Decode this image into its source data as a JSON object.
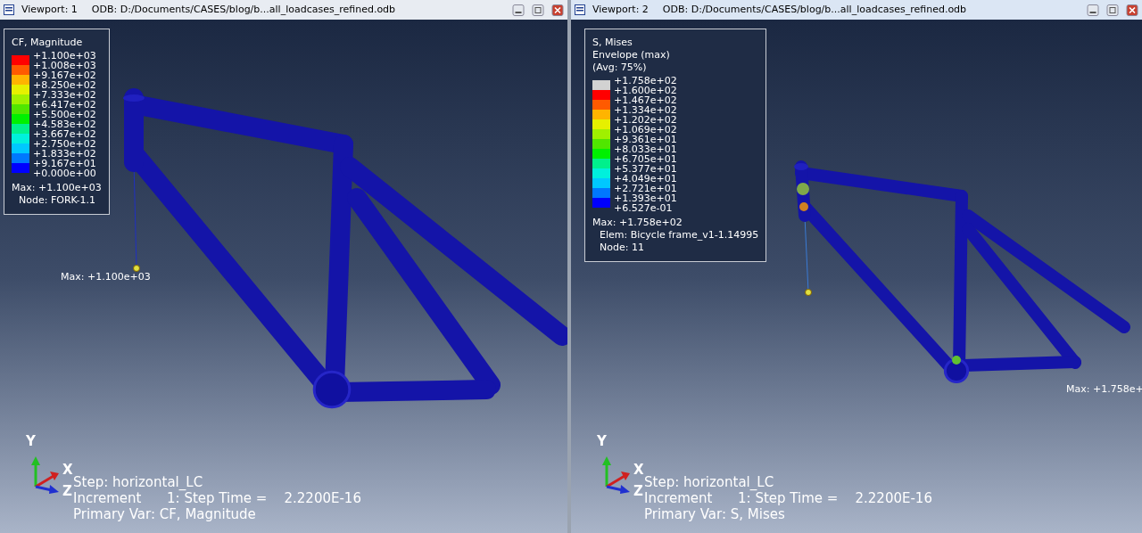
{
  "viewports": [
    {
      "title": "Viewport: 1",
      "odb": "ODB: D:/Documents/CASES/blog/b...all_loadcases_refined.odb",
      "kind": "cf",
      "active": false,
      "legend": {
        "heading": [
          "CF, Magnitude"
        ],
        "values": [
          "+1.100e+03",
          "+1.008e+03",
          "+9.167e+02",
          "+8.250e+02",
          "+7.333e+02",
          "+6.417e+02",
          "+5.500e+02",
          "+4.583e+02",
          "+3.667e+02",
          "+2.750e+02",
          "+1.833e+02",
          "+9.167e+01",
          "+0.000e+00"
        ],
        "bands": [
          {
            "color": "#ff0000"
          },
          {
            "color": "#ff5a00"
          },
          {
            "color": "#ffb400"
          },
          {
            "color": "#e6f000"
          },
          {
            "color": "#a0f000"
          },
          {
            "color": "#50e600"
          },
          {
            "color": "#00f000"
          },
          {
            "color": "#00f08c"
          },
          {
            "color": "#00f0dc"
          },
          {
            "color": "#00c8ff"
          },
          {
            "color": "#0078ff"
          },
          {
            "color": "#0000ff"
          }
        ],
        "info": [
          "Max: +1.100e+03",
          "Node: FORK-1.1"
        ]
      },
      "max_label": "Max: +1.100e+03",
      "triad": {
        "y": "Y",
        "x": "X",
        "z": "Z"
      },
      "step_info": [
        "Step: horizontal_LC",
        "Increment      1: Step Time =    2.2200E-16",
        "Primary Var: CF, Magnitude"
      ]
    },
    {
      "title": "Viewport: 2",
      "odb": "ODB: D:/Documents/CASES/blog/b...all_loadcases_refined.odb",
      "kind": "mises",
      "active": true,
      "legend": {
        "heading": [
          "S, Mises",
          "Envelope (max)",
          "(Avg: 75%)"
        ],
        "values": [
          "+1.758e+02",
          "+1.600e+02",
          "+1.467e+02",
          "+1.334e+02",
          "+1.202e+02",
          "+1.069e+02",
          "+9.361e+01",
          "+8.033e+01",
          "+6.705e+01",
          "+5.377e+01",
          "+4.049e+01",
          "+2.721e+01",
          "+1.393e+01",
          "+6.527e-01"
        ],
        "bands": [
          {
            "color": "#d2d2d2"
          },
          {
            "color": "#ff0000"
          },
          {
            "color": "#ff5a00"
          },
          {
            "color": "#ffb400"
          },
          {
            "color": "#e6f000"
          },
          {
            "color": "#a0f000"
          },
          {
            "color": "#50e600"
          },
          {
            "color": "#00f000"
          },
          {
            "color": "#00f08c"
          },
          {
            "color": "#00f0dc"
          },
          {
            "color": "#00c8ff"
          },
          {
            "color": "#0078ff"
          },
          {
            "color": "#0000ff"
          }
        ],
        "info": [
          "Max: +1.758e+02",
          "Elem: Bicycle frame_v1-1.14995",
          "Node: 11"
        ]
      },
      "max_label": "Max: +1.758e+",
      "triad": {
        "y": "Y",
        "x": "X",
        "z": "Z"
      },
      "step_info": [
        "Step: horizontal_LC",
        "Increment      1: Step Time =    2.2200E-16",
        "Primary Var: S, Mises"
      ]
    }
  ]
}
